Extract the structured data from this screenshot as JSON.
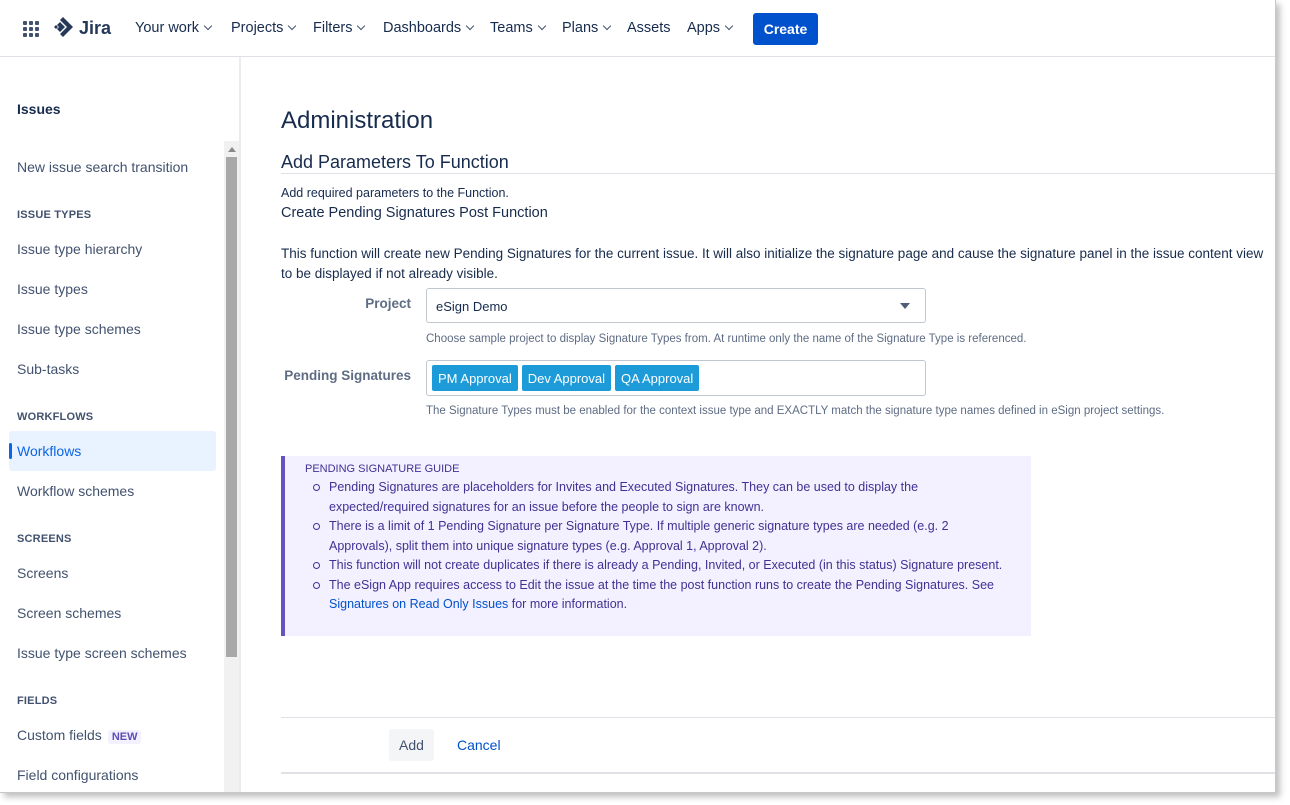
{
  "nav": {
    "app_name": "Jira",
    "items": [
      {
        "label": "Your work"
      },
      {
        "label": "Projects"
      },
      {
        "label": "Filters"
      },
      {
        "label": "Dashboards"
      },
      {
        "label": "Teams"
      },
      {
        "label": "Plans"
      },
      {
        "label": "Assets"
      },
      {
        "label": "Apps"
      }
    ],
    "create_label": "Create"
  },
  "sidebar": {
    "title": "Issues",
    "items": {
      "new_issue_search": "New issue search transition",
      "issue_types_section": "ISSUE TYPES",
      "issue_type_hierarchy": "Issue type hierarchy",
      "issue_types": "Issue types",
      "issue_type_schemes": "Issue type schemes",
      "sub_tasks": "Sub-tasks",
      "workflows_section": "WORKFLOWS",
      "workflows": "Workflows",
      "workflow_schemes": "Workflow schemes",
      "screens_section": "SCREENS",
      "screens": "Screens",
      "screen_schemes": "Screen schemes",
      "issue_type_screen_schemes": "Issue type screen schemes",
      "fields_section": "FIELDS",
      "custom_fields": "Custom fields",
      "custom_fields_badge": "NEW",
      "field_configurations": "Field configurations"
    }
  },
  "main": {
    "title": "Administration",
    "subtitle": "Add Parameters To Function",
    "description": "Add required parameters to the Function.",
    "function_name": "Create Pending Signatures Post Function",
    "paragraph": "This function will create new Pending Signatures for the current issue. It will also initialize the signature page and cause the signature panel in the issue content view to be displayed if not already visible.",
    "project_label": "Project",
    "project_value": "eSign Demo",
    "project_hint": "Choose sample project to display Signature Types from. At runtime only the name of the Signature Type is referenced.",
    "pending_label": "Pending Signatures",
    "tags": [
      "PM Approval",
      "Dev Approval",
      "QA Approval"
    ],
    "pending_hint": "The Signature Types must be enabled for the context issue type and EXACTLY match the signature type names defined in eSign project settings.",
    "guide": {
      "title": "PENDING SIGNATURE GUIDE",
      "item1": "Pending Signatures are placeholders for Invites and Executed Signatures. They can be used to display the expected/required signatures for an issue before the people to sign are known.",
      "item2": "There is a limit of 1 Pending Signature per Signature Type. If multiple generic signature types are needed (e.g. 2 Approvals), split them into unique signature types (e.g. Approval 1, Approval 2).",
      "item3": "This function will not create duplicates if there is already a Pending, Invited, or Executed (in this status) Signature present.",
      "item4_text": "The eSign App requires access to Edit the issue at the time the post function runs to create the Pending Signatures. See ",
      "item4_link": "Signatures on Read Only Issues",
      "item4_suffix": " for more information."
    },
    "add_label": "Add",
    "cancel_label": "Cancel"
  },
  "colors": {
    "primary": "#0052cc",
    "tag": "#1d9bd9",
    "guide_bg": "#f3f0ff",
    "guide_border": "#6554c0",
    "selected_bg": "#e9f2ff"
  }
}
